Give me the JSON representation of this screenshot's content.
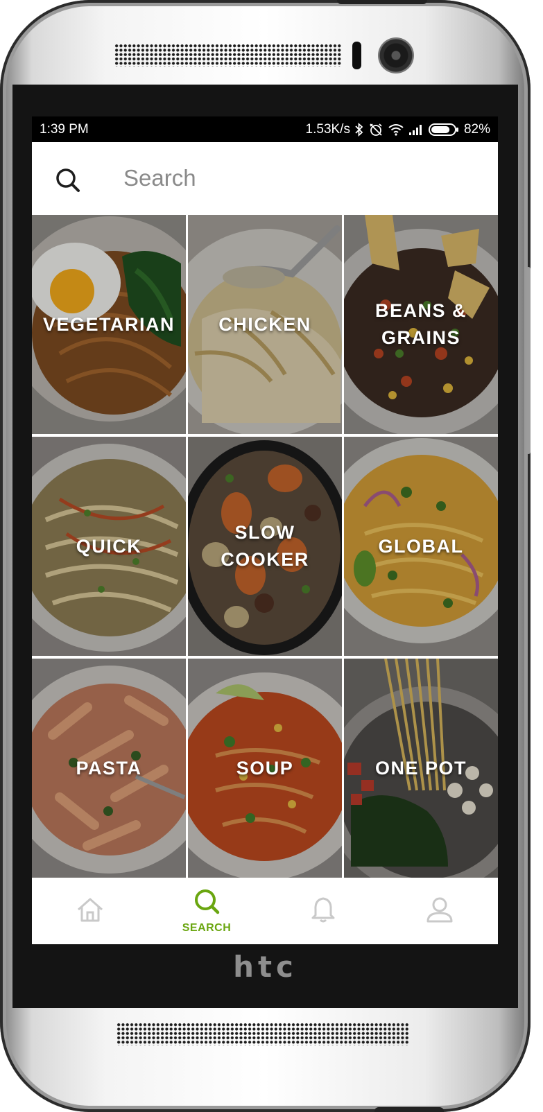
{
  "device": {
    "brand": "htc"
  },
  "status_bar": {
    "time": "1:39  PM",
    "network_speed": "1.53K/s",
    "battery_percent": "82%",
    "battery_level": 0.82,
    "icons": [
      "bluetooth-icon",
      "muted-alarm-icon",
      "wifi-icon",
      "signal-icon",
      "battery-icon"
    ]
  },
  "search": {
    "placeholder": "Search",
    "value": ""
  },
  "categories": [
    {
      "label": "VEGETARIAN"
    },
    {
      "label": "CHICKEN"
    },
    {
      "label": "BEANS &\nGRAINS"
    },
    {
      "label": "QUICK"
    },
    {
      "label": "SLOW\nCOOKER"
    },
    {
      "label": "GLOBAL"
    },
    {
      "label": "PASTA"
    },
    {
      "label": "SOUP"
    },
    {
      "label": "ONE POT"
    }
  ],
  "bottom_nav": {
    "items": [
      {
        "icon": "home-icon",
        "label": "",
        "active": false
      },
      {
        "icon": "search-icon",
        "label": "SEARCH",
        "active": true
      },
      {
        "icon": "bell-icon",
        "label": "",
        "active": false
      },
      {
        "icon": "profile-icon",
        "label": "",
        "active": false
      }
    ],
    "active_color": "#6aa610",
    "inactive_color": "#c9c9c9"
  }
}
